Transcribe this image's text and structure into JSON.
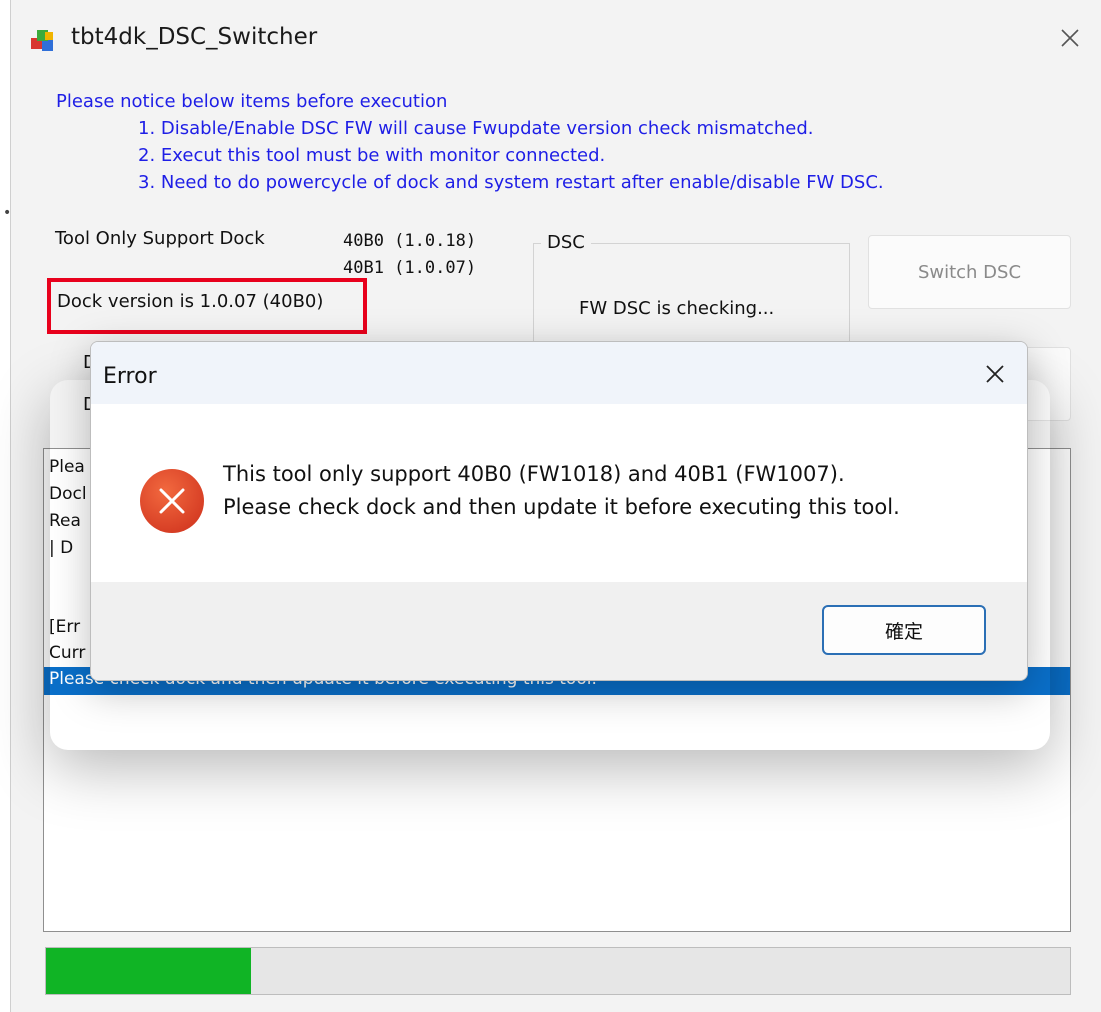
{
  "window": {
    "title": "tbt4dk_DSC_Switcher"
  },
  "notice": {
    "heading": "Please notice below items before execution",
    "items": [
      "1. Disable/Enable DSC FW will cause Fwupdate version check mismatched.",
      "2. Execut this tool must be with monitor connected.",
      "3. Need to do powercycle of dock and system restart after enable/disable FW DSC."
    ]
  },
  "support": {
    "label": "Tool Only Support Dock",
    "versions": [
      "40B0 (1.0.18)",
      "40B1 (1.0.07)"
    ]
  },
  "dock_version": "Dock version is 1.0.07 (40B0)",
  "partial_labels": [
    "D",
    "D"
  ],
  "dsc": {
    "legend": "DSC",
    "status": "FW DSC is checking..."
  },
  "buttons": {
    "switch_dsc": "Switch DSC"
  },
  "log": {
    "lines": [
      "Plea",
      "Docl",
      "Rea",
      "|  D",
      "",
      "",
      "[Err",
      "Curr"
    ],
    "selected_line": "Please check dock and then update it before executing this tool."
  },
  "progress": {
    "value": 0.2
  },
  "dialog": {
    "title": "Error",
    "message_line1": "This tool only support 40B0 (FW1018) and 40B1 (FW1007).",
    "message_line2": "Please check dock and then update it before executing this tool.",
    "ok_label": "確定"
  },
  "colors": {
    "notice_text": "#1e1ee6",
    "highlight_box": "#e8001c",
    "progress_fill": "#10b425",
    "selection": "#0a6fc9",
    "error_icon": "#e2462b"
  },
  "icons": {
    "app": "app-icon",
    "close": "close-icon",
    "error": "error-icon"
  }
}
